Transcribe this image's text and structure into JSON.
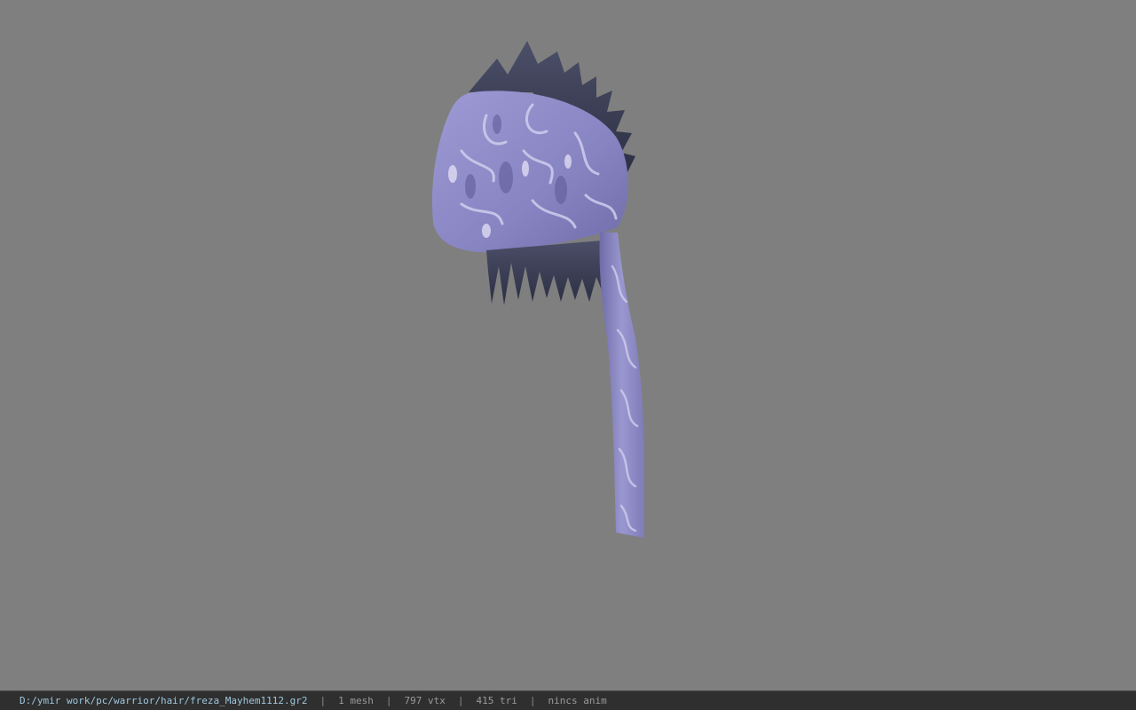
{
  "viewer": {
    "background_color": "#7f7f7f",
    "model_icon": "hair-model-icon"
  },
  "status": {
    "file_path": "D:/ymir work/pc/warrior/hair/freza_Mayhem1112.gr2",
    "separator": "|",
    "mesh_count": "1 mesh",
    "vertex_count": "797 vtx",
    "triangle_count": "415 tri",
    "anim_status": "nincs anim"
  },
  "colors": {
    "status_bar_bg": "#2f2f2f",
    "path_text": "#9ec7de",
    "status_text": "#9a9a9a",
    "cloth_primary": "#8a87c4",
    "cloth_pattern": "#c9c6ea",
    "hair_dark": "#3b3f55"
  }
}
